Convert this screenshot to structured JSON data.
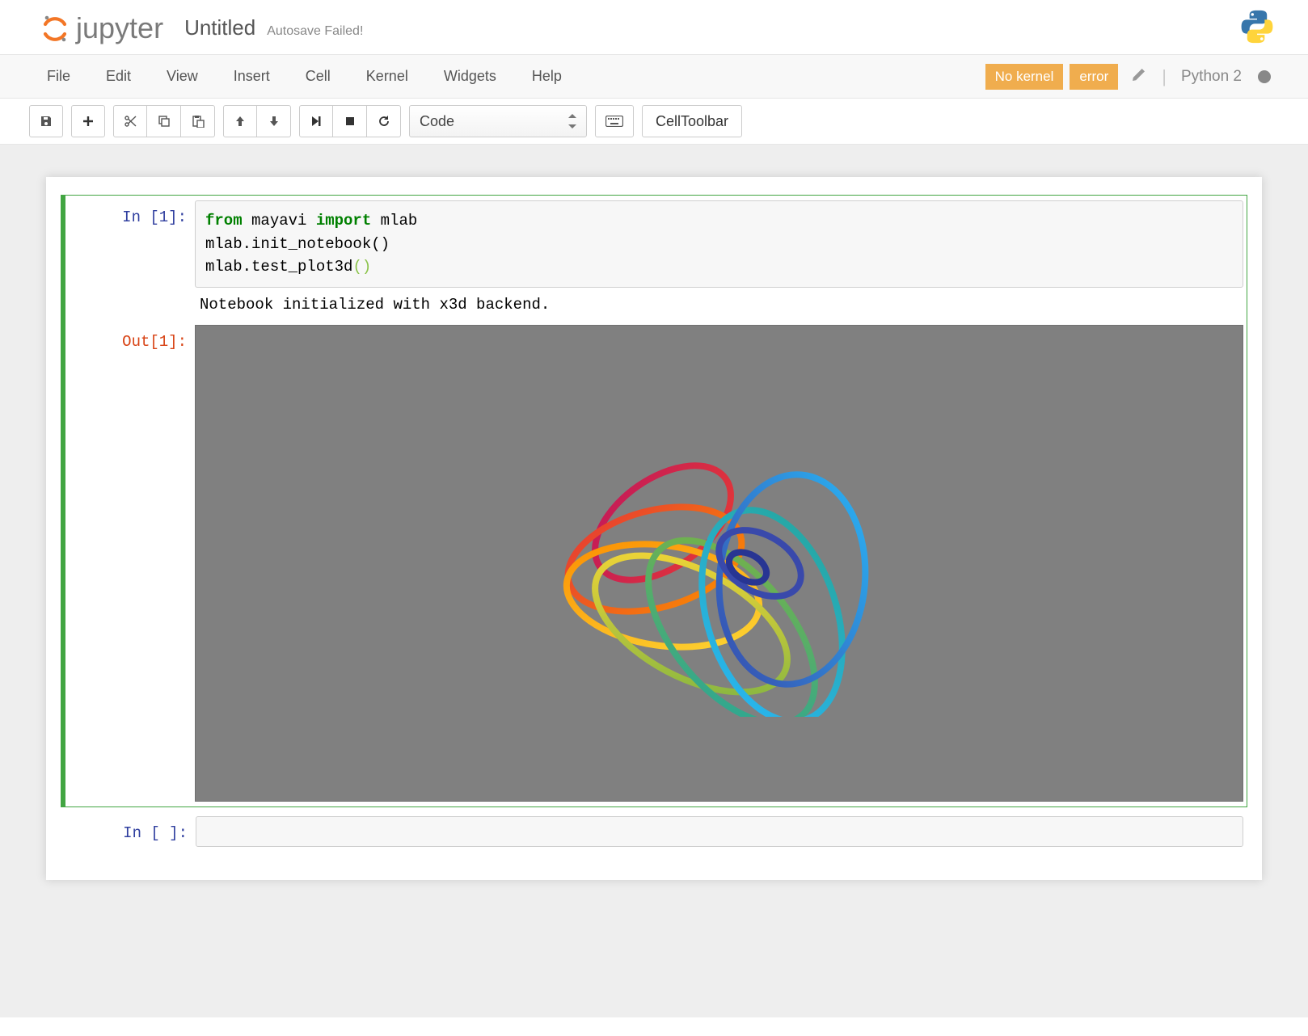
{
  "header": {
    "logo_text": "jupyter",
    "notebook_title": "Untitled",
    "autosave_status": "Autosave Failed!"
  },
  "menubar": {
    "items": [
      "File",
      "Edit",
      "View",
      "Insert",
      "Cell",
      "Kernel",
      "Widgets",
      "Help"
    ],
    "no_kernel_badge": "No kernel",
    "error_badge": "error",
    "kernel_name": "Python 2"
  },
  "toolbar": {
    "cell_type_selected": "Code",
    "celltoolbar_label": "CellToolbar"
  },
  "cells": [
    {
      "in_prompt": "In [1]:",
      "code_tokens": [
        {
          "t": "from",
          "c": "kw"
        },
        {
          "t": " mayavi ",
          "c": "nm"
        },
        {
          "t": "import",
          "c": "kw"
        },
        {
          "t": " mlab",
          "c": "nm"
        },
        {
          "t": "\n",
          "c": "nm"
        },
        {
          "t": "mlab.init_notebook()",
          "c": "nm"
        },
        {
          "t": "\n",
          "c": "nm"
        },
        {
          "t": "mlab.test_plot3d",
          "c": "nm"
        },
        {
          "t": "()",
          "c": "lpn"
        }
      ],
      "stdout": "Notebook initialized with x3d backend.",
      "out_prompt": "Out[1]:"
    },
    {
      "in_prompt": "In [ ]:"
    }
  ]
}
